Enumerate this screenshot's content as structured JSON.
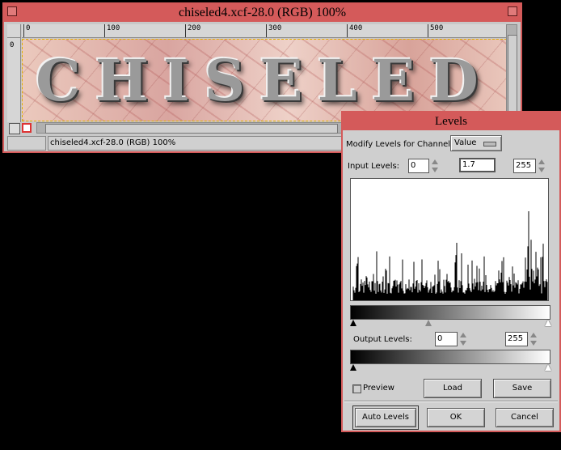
{
  "image_window": {
    "title": "chiseled4.xcf-28.0 (RGB) 100%",
    "ruler_marks": [
      "0",
      "100",
      "200",
      "300",
      "400",
      "500"
    ],
    "vertical_ruler_mark": "0",
    "canvas_text": "CHISELED",
    "status_text": "chiseled4.xcf-28.0 (RGB) 100%"
  },
  "levels_dialog": {
    "title": "Levels",
    "channel_label": "Modify Levels for Channel:",
    "channel_value": "Value",
    "input_levels_label": "Input Levels:",
    "input_low": "0",
    "input_gamma": "1.7",
    "input_high": "255",
    "output_levels_label": "Output Levels:",
    "output_low": "0",
    "output_high": "255",
    "preview_label": "Preview",
    "preview_checked": false,
    "load_label": "Load",
    "save_label": "Save",
    "auto_levels_label": "Auto Levels",
    "ok_label": "OK",
    "cancel_label": "Cancel"
  },
  "colors": {
    "title_bar": "#d45a5a",
    "dialog_bg": "#cfcfcf",
    "desktop": "#000000"
  }
}
